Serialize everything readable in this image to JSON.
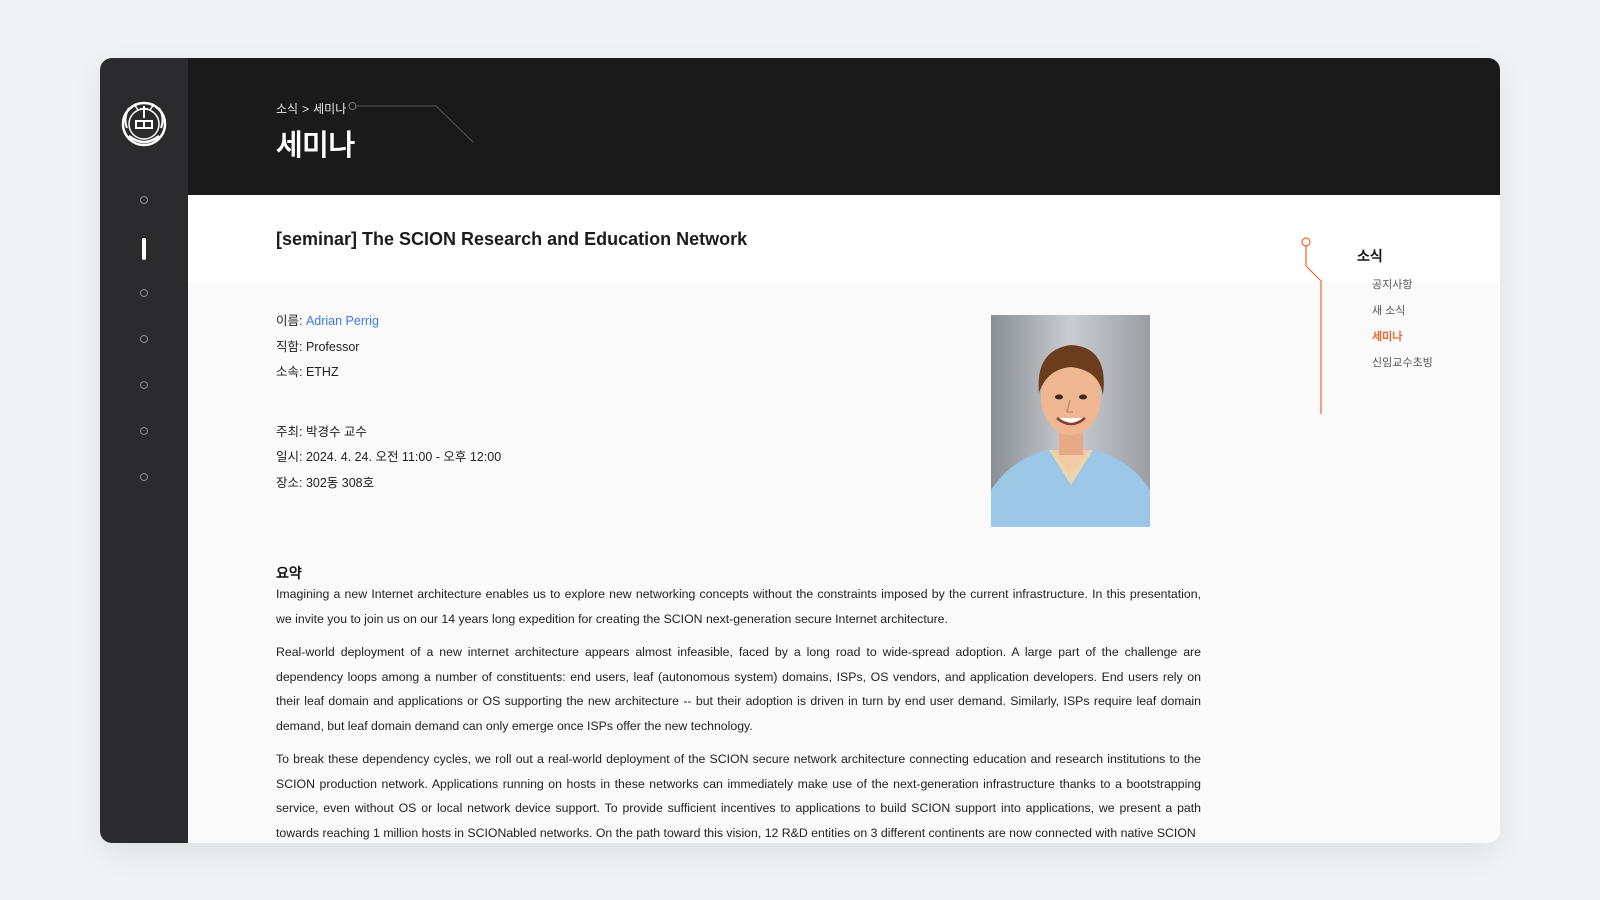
{
  "breadcrumb": {
    "parent": "소식",
    "separator": ">",
    "current": "세미나"
  },
  "page_title": "세미나",
  "rail": {
    "items": [
      "nav-1",
      "nav-2",
      "nav-3",
      "nav-4",
      "nav-5",
      "nav-6",
      "nav-7"
    ],
    "active_index": 1
  },
  "post": {
    "title": "[seminar] The SCION Research and Education Network",
    "name_label": "이름: ",
    "name_value": "Adrian Perrig",
    "position_label": "직함: ",
    "position_value": "Professor",
    "affiliation_label": "소속: ",
    "affiliation_value": "ETHZ",
    "host_label": "주최: ",
    "host_value": "박경수 교수",
    "datetime_label": "일시: ",
    "datetime_value": "2024. 4. 24. 오전 11:00 - 오후 12:00",
    "location_label": "장소: ",
    "location_value": "302동 308호",
    "summary_heading": "요약",
    "summary_paragraphs": [
      "Imagining a new Internet architecture enables us to explore new networking concepts without the constraints imposed by the current infrastructure. In this presentation, we invite you to join us on our 14 years long expedition for creating the SCION next-generation secure Internet architecture.",
      "Real-world deployment of a new internet architecture appears almost infeasible, faced by a long road to wide-spread adoption. A large part of the challenge are dependency loops among a number of constituents: end users, leaf (autonomous system) domains, ISPs, OS vendors, and application developers. End users rely on their leaf domain and applications or OS supporting the new architecture -- but their adoption is driven in turn by end user demand. Similarly, ISPs require leaf domain demand, but leaf domain demand can only emerge once ISPs offer the new technology.",
      "To break these dependency cycles, we roll out a real-world deployment of the SCION secure network architecture connecting education and research institutions to the SCION production network. Applications running on hosts in these networks can immediately make use of the next-generation infrastructure thanks to a bootstrapping service, even without OS or local network device support. To provide sufficient incentives to applications to build SCION support into applications, we present a path towards reaching 1 million hosts in SCIONabled networks. On the path toward this vision, 12 R&D entities on 3 different continents are now connected with native SCION"
    ]
  },
  "side_nav": {
    "heading": "소식",
    "items": [
      "공지사항",
      "새 소식",
      "세미나",
      "신임교수초빙"
    ],
    "active_index": 2
  },
  "colors": {
    "accent": "#f0642a",
    "link": "#3b7be0",
    "header_bg": "#1a1a1a",
    "rail_bg": "#2b2b2d"
  }
}
